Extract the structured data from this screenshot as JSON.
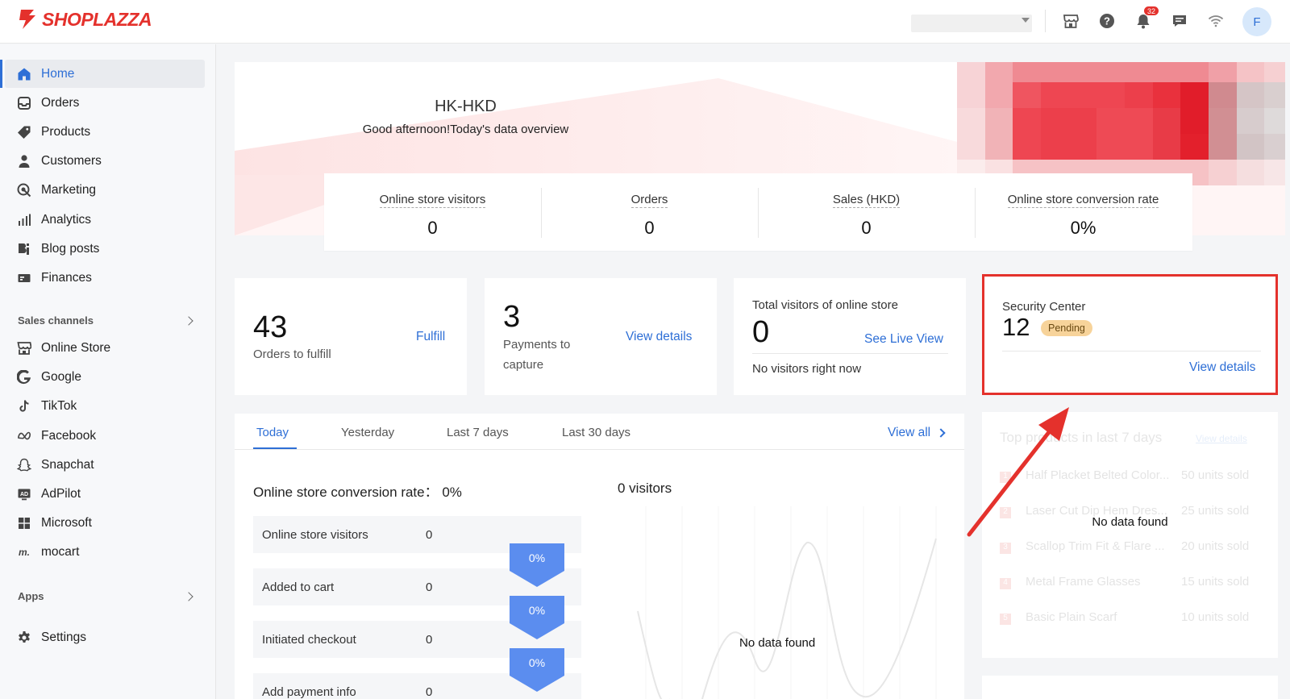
{
  "brand": {
    "name": "SHOPLAZZA",
    "color": "#e4312c"
  },
  "accent": "#2e6fd6",
  "topbar": {
    "notification_count": "32",
    "avatar_initial": "F",
    "icons": [
      "store-icon",
      "help-icon",
      "bell-icon",
      "chat-icon",
      "wifi-icon"
    ]
  },
  "sidebar": {
    "items": [
      {
        "label": "Home",
        "icon": "home-icon",
        "active": true
      },
      {
        "label": "Orders",
        "icon": "orders-icon"
      },
      {
        "label": "Products",
        "icon": "tag-icon"
      },
      {
        "label": "Customers",
        "icon": "user-icon"
      },
      {
        "label": "Marketing",
        "icon": "marketing-icon"
      },
      {
        "label": "Analytics",
        "icon": "analytics-icon"
      },
      {
        "label": "Blog posts",
        "icon": "blog-icon"
      },
      {
        "label": "Finances",
        "icon": "finances-icon"
      }
    ],
    "sales_channels_label": "Sales channels",
    "channels": [
      {
        "label": "Online Store",
        "icon": "store-icon"
      },
      {
        "label": "Google",
        "icon": "google-icon"
      },
      {
        "label": "TikTok",
        "icon": "tiktok-icon"
      },
      {
        "label": "Facebook",
        "icon": "meta-icon"
      },
      {
        "label": "Snapchat",
        "icon": "snapchat-icon"
      },
      {
        "label": "AdPilot",
        "icon": "adpilot-icon"
      },
      {
        "label": "Microsoft",
        "icon": "microsoft-icon"
      },
      {
        "label": "mocart",
        "icon": "mocart-icon"
      }
    ],
    "apps_label": "Apps",
    "settings_label": "Settings"
  },
  "hero": {
    "store": "HK-HKD",
    "greeting": "Good afternoon!Today's data overview"
  },
  "stats": [
    {
      "label": "Online store visitors",
      "value": "0"
    },
    {
      "label": "Orders",
      "value": "0"
    },
    {
      "label": "Sales (HKD)",
      "value": "0"
    },
    {
      "label": "Online store conversion rate",
      "value": "0%"
    }
  ],
  "fulfill": {
    "count": "43",
    "label": "Orders to fulfill",
    "action": "Fulfill"
  },
  "payments": {
    "count": "3",
    "label_line1": "Payments to",
    "label_line2": "capture",
    "action": "View details"
  },
  "visitors": {
    "title": "Total visitors of online store",
    "count": "0",
    "action": "See Live View",
    "note": "No visitors right now"
  },
  "security": {
    "title": "Security Center",
    "count": "12",
    "status": "Pending",
    "action": "View details"
  },
  "tabs": {
    "items": [
      "Today",
      "Yesterday",
      "Last 7 days",
      "Last 30 days"
    ],
    "view_all": "View all",
    "conversion_label": "Online store conversion rate： 0%",
    "visitors_label": "0 visitors",
    "no_data": "No data found",
    "funnel": [
      {
        "label": "Online store visitors",
        "value": "0"
      },
      {
        "label": "Added to cart",
        "value": "0"
      },
      {
        "label": "Initiated checkout",
        "value": "0"
      },
      {
        "label": "Add payment info",
        "value": "0"
      }
    ],
    "funnel_rates": [
      "0%",
      "0%",
      "0%"
    ]
  },
  "top_products": {
    "title": "Top products in last 7 days",
    "action": "View details",
    "no_data": "No data found",
    "rows": [
      {
        "rank": "1",
        "name": "Half Placket Belted Color...",
        "sold": "50 units sold"
      },
      {
        "rank": "2",
        "name": "Laser Cut Dip Hem Dres...",
        "sold": "25 units sold"
      },
      {
        "rank": "3",
        "name": "Scallop Trim Fit & Flare ...",
        "sold": "20 units sold"
      },
      {
        "rank": "4",
        "name": "Metal Frame Glasses",
        "sold": "15 units sold"
      },
      {
        "rank": "5",
        "name": "Basic Plain Scarf",
        "sold": "10 units sold"
      }
    ]
  }
}
